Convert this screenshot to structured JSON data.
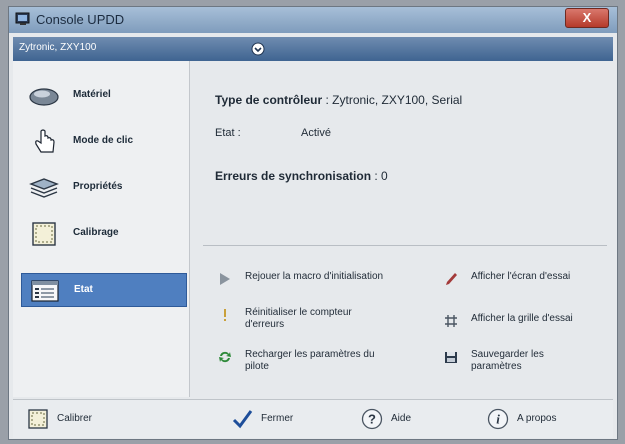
{
  "window": {
    "title": "Console UPDD",
    "close_label": "X"
  },
  "device": {
    "selected": "Zytronic, ZXY100"
  },
  "sidebar": {
    "items": [
      {
        "label": "Matériel",
        "icon": "mouse-icon"
      },
      {
        "label": "Mode de clic",
        "icon": "hand-pointer-icon"
      },
      {
        "label": "Propriétés",
        "icon": "layers-icon"
      },
      {
        "label": "Calibrage",
        "icon": "calibration-grid-icon"
      },
      {
        "label": "Etat",
        "icon": "status-window-icon",
        "active": true
      }
    ]
  },
  "main": {
    "controller_label": "Type de contrôleur",
    "controller_value": ": Zytronic, ZXY100, Serial",
    "state_label": "Etat :",
    "state_value": "Activé",
    "sync_errors_label": "Erreurs de synchronisation",
    "sync_errors_value": ": 0"
  },
  "actions": {
    "replay_macro": "Rejouer la macro d'initialisation",
    "reset_counter_1": "Réinitialiser le compteur",
    "reset_counter_2": "d'erreurs",
    "reload_1": "Recharger les paramètres du",
    "reload_2": "pilote",
    "test_screen": "Afficher l'écran d'essai",
    "test_grid": "Afficher la grille d'essai",
    "save_1": "Sauvegarder les",
    "save_2": "paramètres"
  },
  "footer": {
    "calibrate": "Calibrer",
    "close": "Fermer",
    "help": "Aide",
    "about": "A propos"
  },
  "colors": {
    "title_bar": "#8aa6c4",
    "device_bar": "#4a6e99",
    "active_item": "#4f7fc0",
    "close_button": "#c2473a"
  }
}
